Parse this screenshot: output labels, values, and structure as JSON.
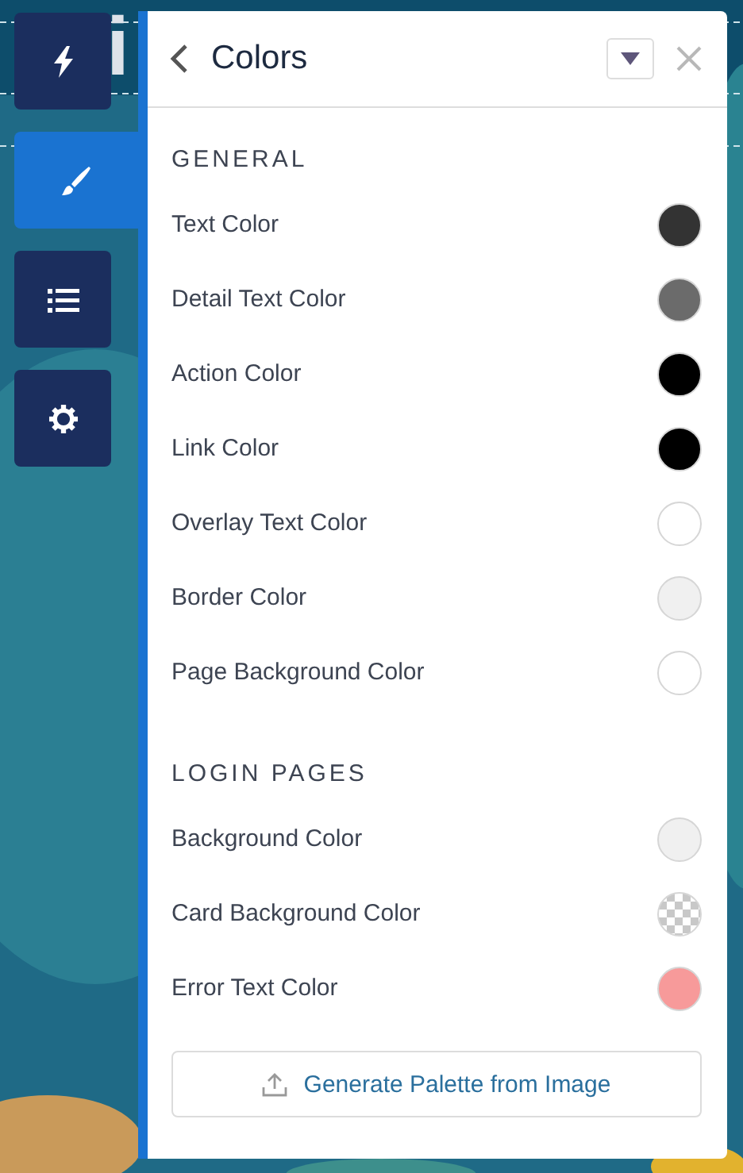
{
  "background_text": "i",
  "rail": [
    {
      "kind": "bolt",
      "selected": false
    },
    {
      "kind": "brush",
      "selected": true
    },
    {
      "kind": "list",
      "selected": false
    },
    {
      "kind": "gear",
      "selected": false
    }
  ],
  "panel": {
    "title": "Colors",
    "sections": [
      {
        "heading": "GENERAL",
        "items": [
          {
            "label": "Text Color",
            "kind": "solid",
            "color": "#333333"
          },
          {
            "label": "Detail Text Color",
            "kind": "solid",
            "color": "#6b6b6b"
          },
          {
            "label": "Action Color",
            "kind": "solid",
            "color": "#000000"
          },
          {
            "label": "Link Color",
            "kind": "solid",
            "color": "#000000"
          },
          {
            "label": "Overlay Text Color",
            "kind": "solid",
            "color": "#ffffff"
          },
          {
            "label": "Border Color",
            "kind": "solid",
            "color": "#f0f0f0"
          },
          {
            "label": "Page Background Color",
            "kind": "solid",
            "color": "#ffffff"
          }
        ]
      },
      {
        "heading": "LOGIN PAGES",
        "items": [
          {
            "label": "Background Color",
            "kind": "solid",
            "color": "#f0f0f0"
          },
          {
            "label": "Card Background Color",
            "kind": "transparent"
          },
          {
            "label": "Error Text Color",
            "kind": "solid",
            "color": "#f79a9a"
          }
        ]
      }
    ],
    "button": "Generate Palette from Image"
  }
}
